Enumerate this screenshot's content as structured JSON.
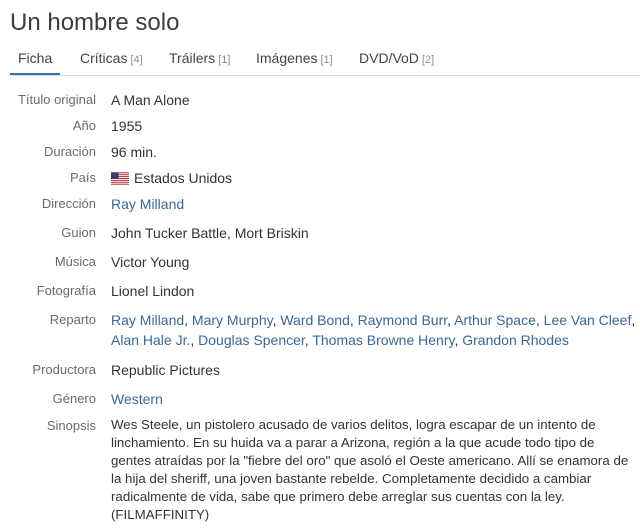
{
  "movie": {
    "title": "Un hombre solo"
  },
  "tabs": [
    {
      "label": "Ficha",
      "count": ""
    },
    {
      "label": "Críticas",
      "count": "[4]"
    },
    {
      "label": "Tráilers",
      "count": "[1]"
    },
    {
      "label": "Imágenes",
      "count": "[1]"
    },
    {
      "label": "DVD/VoD",
      "count": "[2]"
    }
  ],
  "details": {
    "original_title": {
      "label": "Título original",
      "value": "A Man Alone"
    },
    "year": {
      "label": "Año",
      "value": "1955"
    },
    "duration": {
      "label": "Duración",
      "value": "96 min."
    },
    "country": {
      "label": "País",
      "value": "Estados Unidos",
      "flag_icon": "us-flag-icon"
    },
    "director": {
      "label": "Dirección",
      "value": "Ray Milland"
    },
    "screenplay": {
      "label": "Guion",
      "value": "John Tucker Battle, Mort Briskin"
    },
    "music": {
      "label": "Música",
      "value": "Victor Young"
    },
    "photography": {
      "label": "Fotografía",
      "value": "Lionel Lindon"
    },
    "cast": {
      "label": "Reparto",
      "members": [
        "Ray Milland",
        "Mary Murphy",
        "Ward Bond",
        "Raymond Burr",
        "Arthur Space",
        "Lee Van Cleef",
        "Alan Hale Jr.",
        "Douglas Spencer",
        "Thomas Browne Henry",
        "Grandon Rhodes"
      ]
    },
    "producer": {
      "label": "Productora",
      "value": "Republic Pictures"
    },
    "genre": {
      "label": "Género",
      "value": "Western"
    },
    "synopsis": {
      "label": "Sinopsis",
      "value": "Wes Steele, un pistolero acusado de varios delitos, logra escapar de un intento de linchamiento. En su huida va a parar a Arizona, región a la que acude todo tipo de gentes atraídas por la \"fiebre del oro\" que asoló el Oeste americano. Allí se enamora de la hija del sheriff, una joven bastante rebelde. Completamente decidido a cambiar radicalmente de vida, sabe que primero debe arreglar sus cuentas con la ley. (FILMAFFINITY)"
    }
  },
  "colors": {
    "link": "#3b6894",
    "label": "#6a6a6a",
    "tab_active_underline": "#3a6fa5",
    "tab_border": "#cfdbe8"
  }
}
